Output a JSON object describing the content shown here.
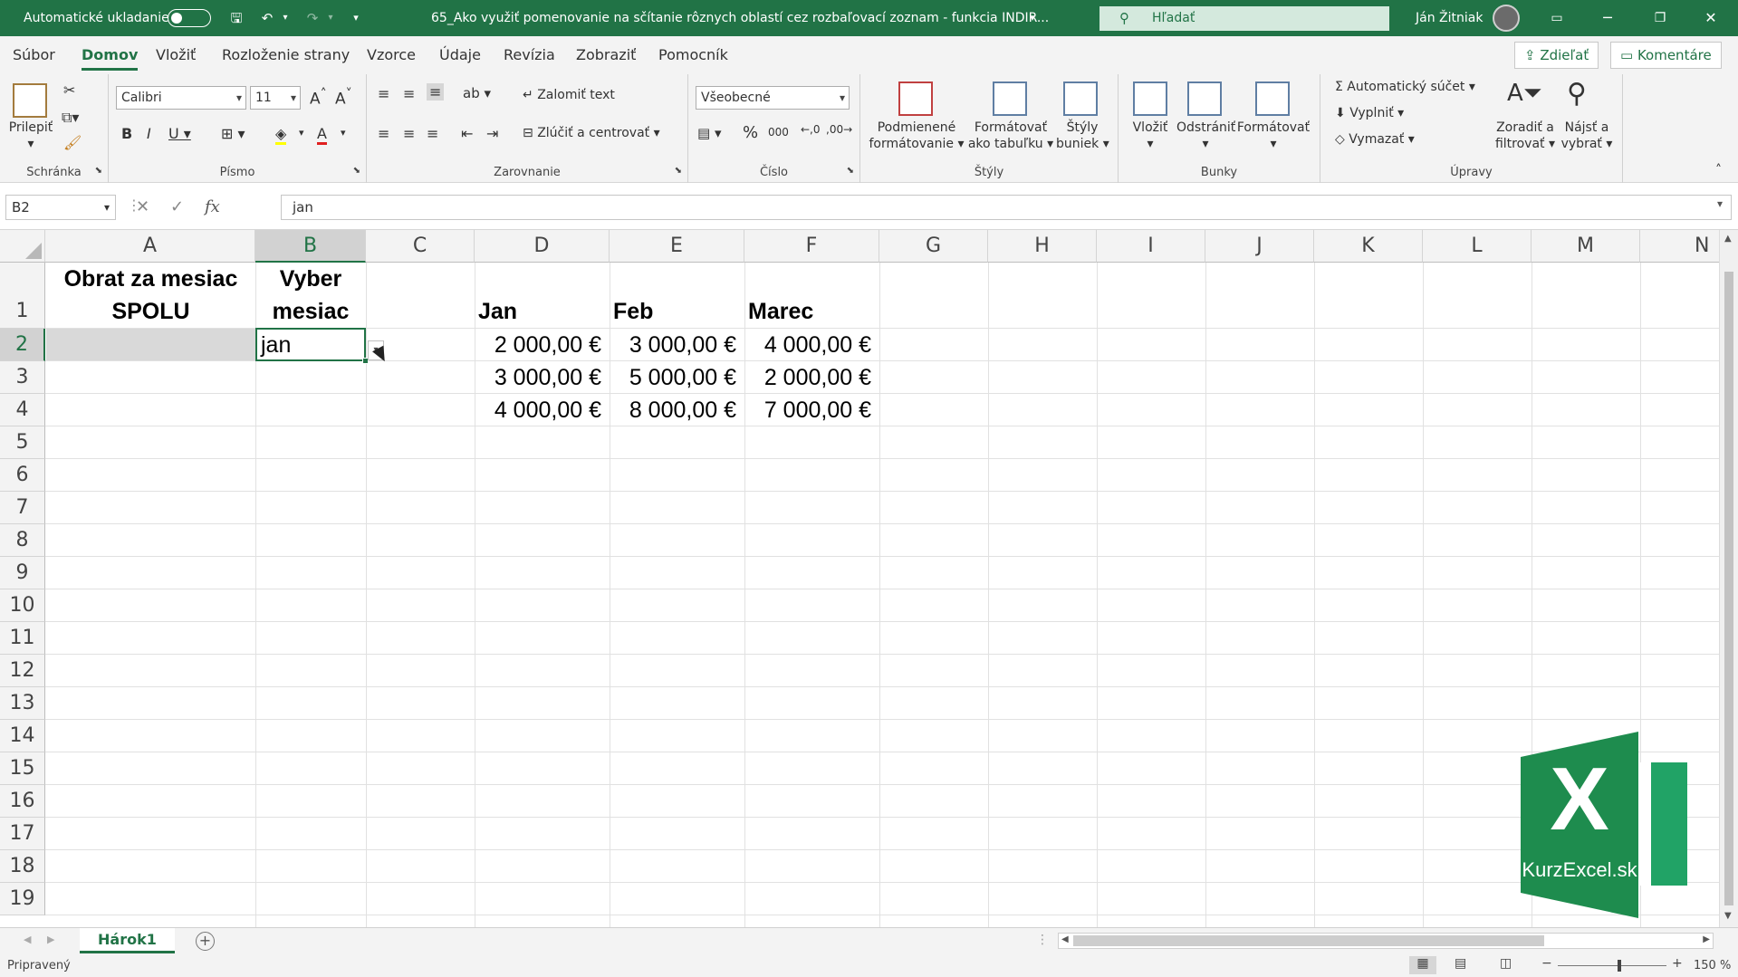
{
  "titlebar": {
    "autosave_label": "Automatické ukladanie",
    "document_title": "65_Ako využiť pomenovanie na sčítanie rôznych oblastí cez rozbaľovací zoznam - funkcia INDIR...",
    "search_placeholder": "Hľadať",
    "user_name": "Ján Žitniak"
  },
  "menu": {
    "tabs": [
      "Súbor",
      "Domov",
      "Vložiť",
      "Rozloženie strany",
      "Vzorce",
      "Údaje",
      "Revízia",
      "Zobraziť",
      "Pomocník"
    ],
    "share_label": "Zdieľať",
    "comments_label": "Komentáre"
  },
  "ribbon": {
    "clipboard": {
      "paste": "Prilepiť",
      "group": "Schránka"
    },
    "font": {
      "family": "Calibri",
      "size": "11",
      "group": "Písmo"
    },
    "alignment": {
      "wrap": "Zalomiť text",
      "merge": "Zlúčiť a centrovať",
      "group": "Zarovnanie"
    },
    "number": {
      "format": "Všeobecné",
      "group": "Číslo"
    },
    "styles": {
      "conditional_l1": "Podmienené",
      "conditional_l2": "formátovanie",
      "table_l1": "Formátovať",
      "table_l2": "ako tabuľku",
      "cell_l1": "Štýly",
      "cell_l2": "buniek",
      "group": "Štýly"
    },
    "cells": {
      "insert": "Vložiť",
      "delete": "Odstrániť",
      "format": "Formátovať",
      "group": "Bunky"
    },
    "editing": {
      "autosum": "Automatický súčet",
      "fill": "Vyplniť",
      "clear": "Vymazať",
      "sort_l1": "Zoradiť a",
      "sort_l2": "filtrovať",
      "find_l1": "Nájsť a",
      "find_l2": "vybrať",
      "group": "Úpravy"
    }
  },
  "formula_bar": {
    "name_box": "B2",
    "fx": "fx",
    "content": "jan"
  },
  "sheet": {
    "columns": [
      "A",
      "B",
      "C",
      "D",
      "E",
      "F",
      "G",
      "H",
      "I",
      "J",
      "K",
      "L",
      "M",
      "N"
    ],
    "rows": [
      "1",
      "2",
      "3",
      "4",
      "5",
      "6",
      "7",
      "8",
      "9",
      "10",
      "11",
      "12",
      "13",
      "14",
      "15",
      "16",
      "17",
      "18",
      "19"
    ],
    "cells": {
      "a1_l1": "Obrat za mesiac",
      "a1_l2": "SPOLU",
      "b1_l1": "Vyber",
      "b1_l2": "mesiac",
      "b2": "jan",
      "d1": "Jan",
      "e1": "Feb",
      "f1": "Marec",
      "d2": "2 000,00 €",
      "e2": "3 000,00 €",
      "f2": "4 000,00 €",
      "d3": "3 000,00 €",
      "e3": "5 000,00 €",
      "f3": "2 000,00 €",
      "d4": "4 000,00 €",
      "e4": "8 000,00 €",
      "f4": "7 000,00 €"
    },
    "sheet_tab": "Hárok1"
  },
  "status": {
    "ready": "Pripravený",
    "zoom": "150 %"
  },
  "logo": {
    "text": "KurzExcel.sk"
  }
}
